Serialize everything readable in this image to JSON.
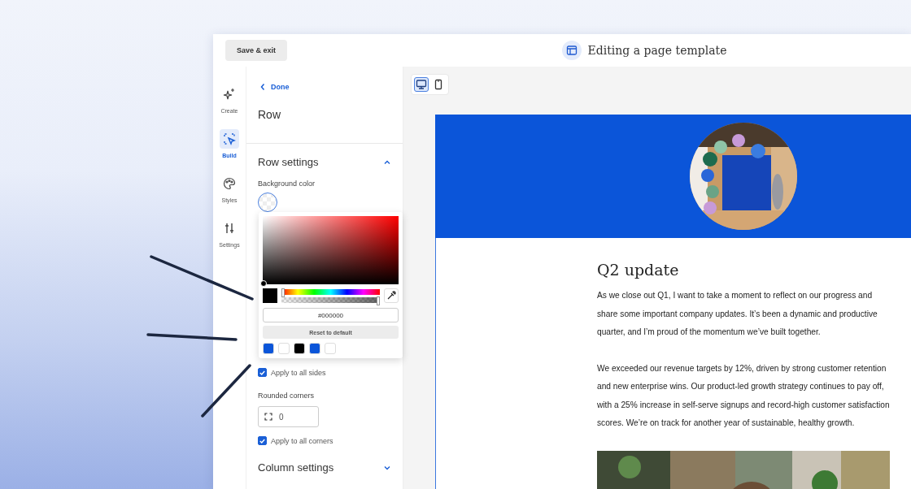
{
  "header": {
    "save_button": "Save & exit",
    "title": "Editing a page template"
  },
  "rail": [
    {
      "kind": "sparkle",
      "label": "Create",
      "selected": false
    },
    {
      "kind": "build",
      "label": "Build",
      "selected": true
    },
    {
      "kind": "palette",
      "label": "Styles",
      "selected": false
    },
    {
      "kind": "sliders",
      "label": "Settings",
      "selected": false
    }
  ],
  "panel": {
    "back": "Done",
    "heading": "Row",
    "row_settings": {
      "title": "Row settings",
      "expanded": true
    },
    "background_label": "Background color",
    "color_picker": {
      "hex": "#000000",
      "hue": {
        "level": 0
      },
      "alpha": {
        "level": 1
      },
      "reset": "Reset to default",
      "swatches": [
        {
          "color": "#0b55d9"
        },
        {
          "color": "#ffffff"
        },
        {
          "color": "#000000"
        },
        {
          "color": "#0b55d9"
        },
        {
          "color": "#ffffff"
        }
      ]
    },
    "apply_sides": {
      "label": "Apply to all sides",
      "checked": true
    },
    "rounded_label": "Rounded corners",
    "rounded_value": "0",
    "apply_corners": {
      "label": "Apply to all corners",
      "checked": true
    },
    "column_settings": {
      "title": "Column settings",
      "expanded": false
    }
  },
  "canvas": {
    "devices": [
      {
        "kind": "desktop",
        "selected": true
      },
      {
        "kind": "mobile",
        "selected": false
      }
    ],
    "email": {
      "heading": "Q2 update",
      "paragraphs": [
        "As we close out Q1, I want to take a moment to reflect on our progress and share some important company updates. It’s been a dynamic and productive quarter, and I’m proud of the momentum we’ve built together.",
        "We exceeded our revenue targets by 12%, driven by strong customer retention and new enterprise wins. Our product-led growth strategy continues to pay off, with a 25% increase in self-serve signups and record-high customer satisfaction scores. We’re on track for another year of sustainable, healthy growth."
      ]
    }
  }
}
